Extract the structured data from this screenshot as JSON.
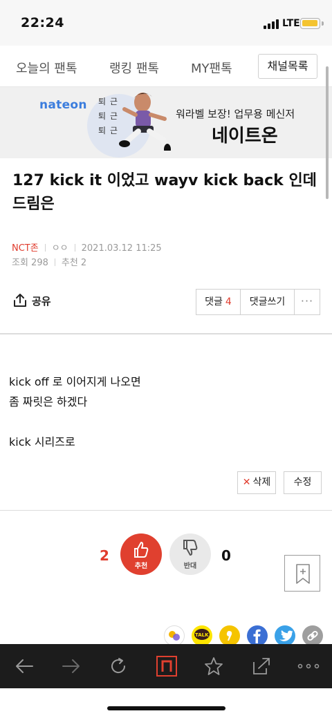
{
  "status_bar": {
    "time": "22:24",
    "network": "LTE"
  },
  "nav": {
    "tabs": [
      "오늘의 팬톡",
      "랭킹 팬톡",
      "MY팬톡"
    ],
    "channel_list": "채널목록"
  },
  "banner": {
    "logo": "nateon",
    "character_text": [
      "퇴근",
      "퇴근",
      "퇴근"
    ],
    "subtitle": "워라벨 보장! 업무용 메신저",
    "title": "네이트온"
  },
  "post": {
    "title": "127 kick it 이었고 wayv kick back 인데 드림은",
    "channel": "NCT존",
    "author": "ㅇㅇ",
    "datetime": "2021.03.12 11:25",
    "views": "조회 298",
    "recommends": "추천 2",
    "body": [
      "kick off 로 이어지게 나오면",
      "좀 짜릿은 하겠다",
      "",
      "kick 시리즈로"
    ]
  },
  "actions": {
    "share": "공유",
    "comments_label": "댓글",
    "comments_count": "4",
    "write_comment": "댓글쓰기",
    "more": "···",
    "delete": "삭제",
    "edit": "수정"
  },
  "votes": {
    "recommend_count": "2",
    "recommend_label": "추천",
    "oppose_label": "반대",
    "oppose_count": "0"
  },
  "social": {
    "talk_label": "TALK",
    "icons": [
      "kakao-story-icon",
      "kakao-talk-icon",
      "kakao-channel-icon",
      "facebook-icon",
      "twitter-icon",
      "link-icon"
    ]
  },
  "colors": {
    "accent": "#e03b2c",
    "brand_blue": "#3b7ddd",
    "toolbar_bg": "#1c1c1c"
  }
}
